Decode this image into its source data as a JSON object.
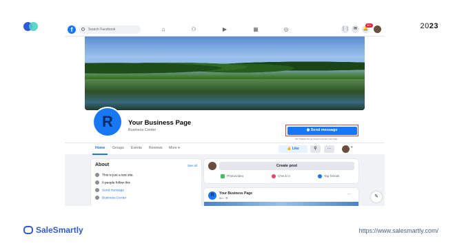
{
  "branding": {
    "year_prefix": "20",
    "year_suffix": "23",
    "brand_name": "SaleSmartly",
    "url": "https://www.salesmartly.com/"
  },
  "facebook": {
    "logo_letter": "f",
    "search_placeholder": "Search Facebook",
    "notification_badge": "20+",
    "page": {
      "avatar_letter": "R",
      "name": "Your Business Page",
      "category": "Business Center",
      "send_message_label": "Send message",
      "hint": "Hi! Please let us know how we can help."
    },
    "tabs": [
      "Home",
      "Groups",
      "Events",
      "Reviews",
      "More ▾"
    ],
    "like_label": "Like",
    "about": {
      "title": "About",
      "see_all": "See all",
      "rows": [
        {
          "text": "This is just a test site."
        },
        {
          "text": "0 people follow this"
        },
        {
          "text": "Send message"
        },
        {
          "text": "Business Center"
        }
      ]
    },
    "create_post": {
      "label": "Create post",
      "options": [
        "Photo/video",
        "Check in",
        "Tag friends"
      ]
    },
    "post": {
      "avatar_letter": "R",
      "name": "Your Business Page",
      "time": "5m · ⚙"
    }
  },
  "colors": {
    "fb_blue": "#1877f2",
    "brand_blue": "#2d5bd7",
    "highlight_border": "#e0403a"
  }
}
